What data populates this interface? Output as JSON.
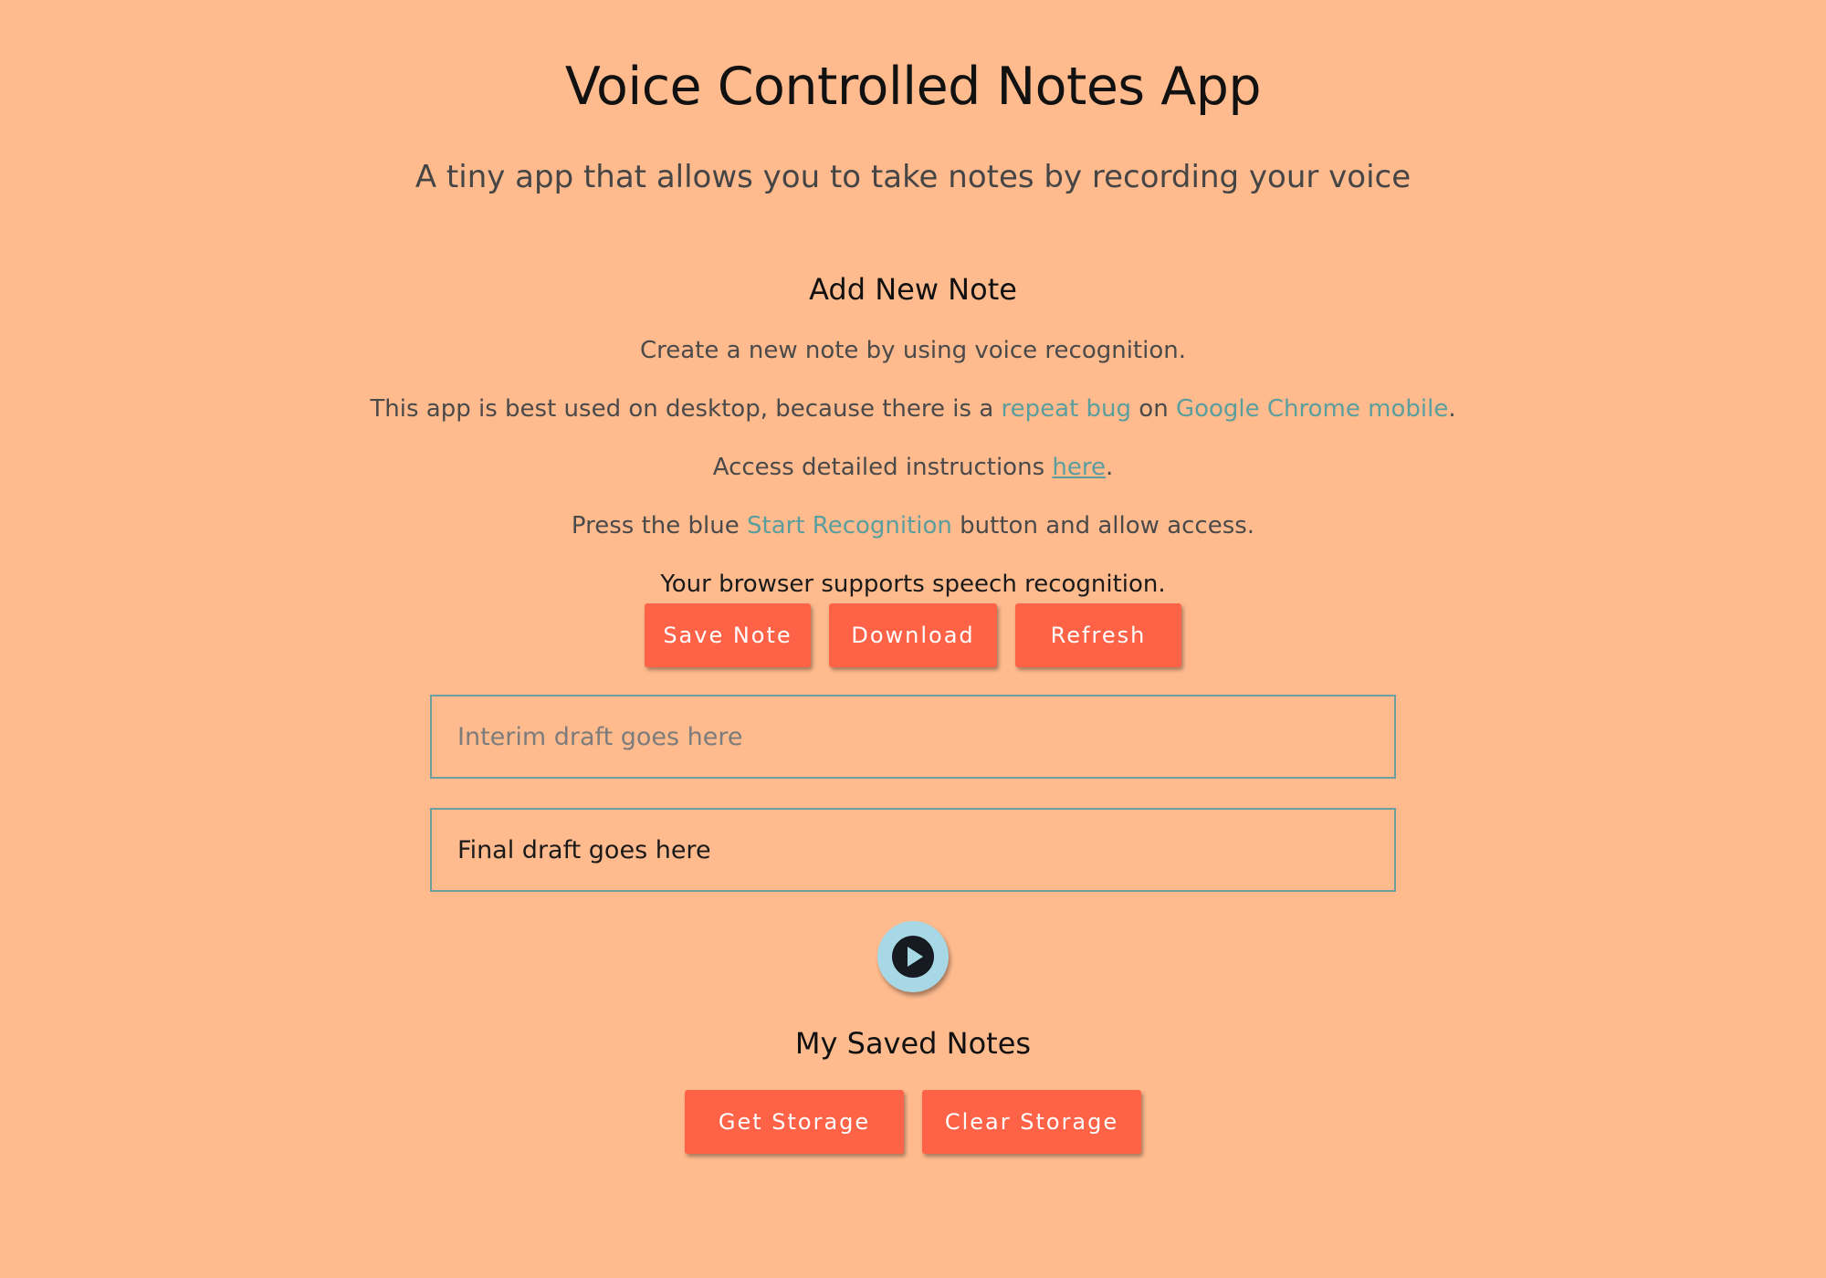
{
  "header": {
    "title": "Voice Controlled Notes App",
    "subtitle": "A tiny app that allows you to take notes by recording your voice"
  },
  "add_note": {
    "heading": "Add New Note",
    "intro": "Create a new note by using voice recognition.",
    "desktop_note": {
      "before": "This app is best used on desktop, because there is a ",
      "link1": "repeat bug",
      "middle": " on ",
      "link2": "Google Chrome mobile",
      "after": "."
    },
    "instructions": {
      "before": "Access detailed instructions ",
      "link": "here",
      "after": "."
    },
    "press": {
      "before": "Press the blue ",
      "highlight": "Start Recognition",
      "after": " button and allow access."
    },
    "support_status": "Your browser supports speech recognition.",
    "buttons": {
      "save": "Save Note",
      "download": "Download",
      "refresh": "Refresh"
    },
    "interim_placeholder": "Interim draft goes here",
    "final_placeholder": "Final draft goes here",
    "play_icon": "play-icon"
  },
  "saved_notes": {
    "heading": "My Saved Notes",
    "buttons": {
      "get": "Get Storage",
      "clear": "Clear Storage"
    }
  },
  "colors": {
    "background": "#FFBB8E",
    "button": "#FF6347",
    "link": "#5A9E9E",
    "field_border": "#6F9E9E",
    "play_button": "#A8D8E6"
  }
}
